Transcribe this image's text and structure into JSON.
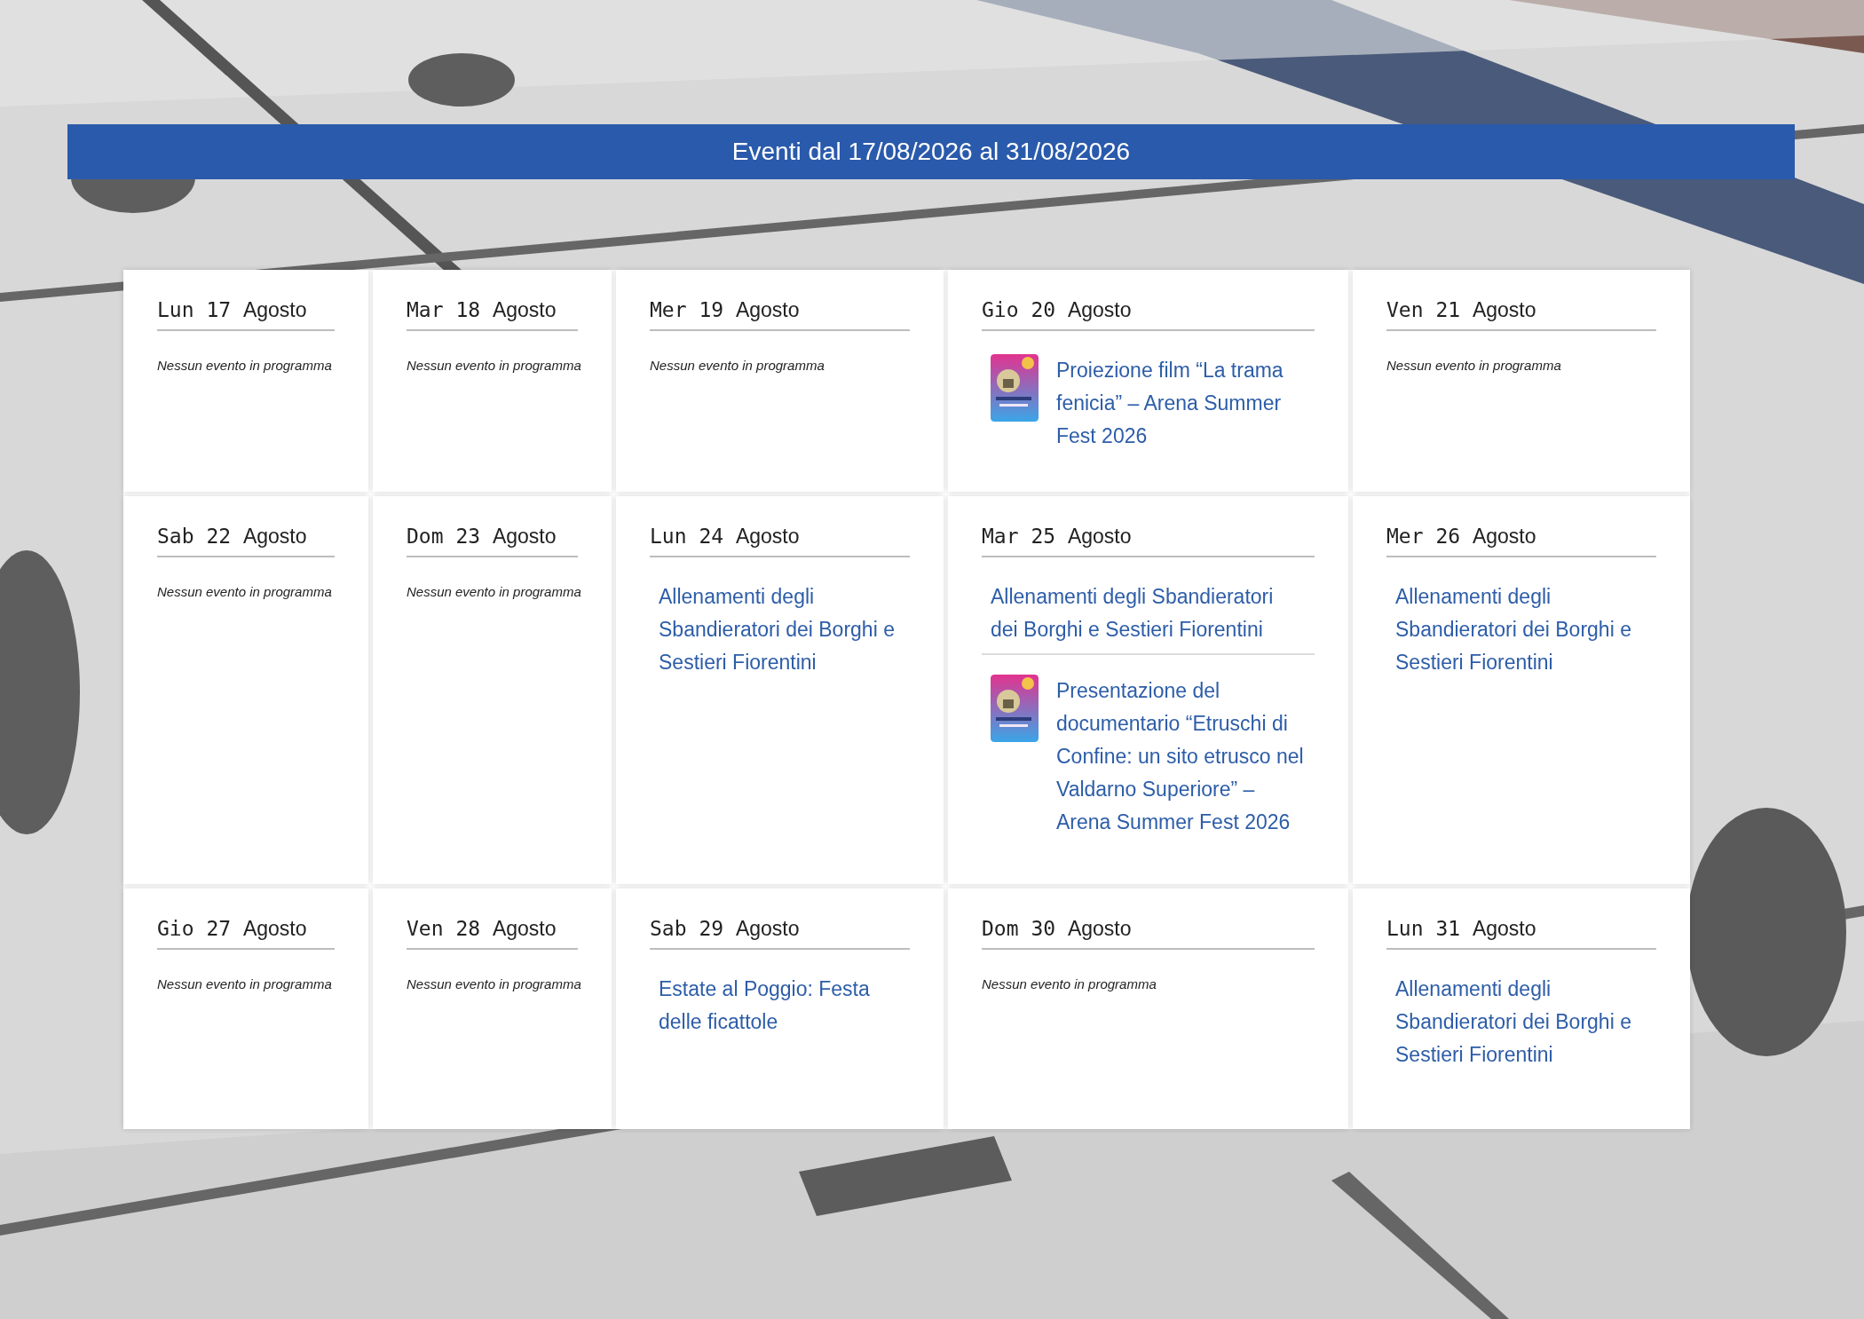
{
  "banner": {
    "title": "Eventi dal 17/08/2026 al 31/08/2026"
  },
  "days": [
    {
      "weekday": "Lun",
      "day": "17",
      "month": "Agosto",
      "empty_text": "Nessun evento in programma"
    },
    {
      "weekday": "Mar",
      "day": "18",
      "month": "Agosto",
      "empty_text": "Nessun evento in programma"
    },
    {
      "weekday": "Mer",
      "day": "19",
      "month": "Agosto",
      "empty_text": "Nessun evento in programma"
    },
    {
      "weekday": "Gio",
      "day": "20",
      "month": "Agosto",
      "events": [
        {
          "kind": "poster",
          "title": "Proiezione film “La trama fenicia” – Arena Summer Fest 2026"
        }
      ]
    },
    {
      "weekday": "Ven",
      "day": "21",
      "month": "Agosto",
      "empty_text": "Nessun evento in programma"
    },
    {
      "weekday": "Sab",
      "day": "22",
      "month": "Agosto",
      "empty_text": "Nessun evento in programma"
    },
    {
      "weekday": "Dom",
      "day": "23",
      "month": "Agosto",
      "empty_text": "Nessun evento in programma"
    },
    {
      "weekday": "Lun",
      "day": "24",
      "month": "Agosto",
      "events": [
        {
          "kind": "plain",
          "title": "Allenamenti degli Sbandieratori dei Borghi e Sestieri Fiorentini"
        }
      ]
    },
    {
      "weekday": "Mar",
      "day": "25",
      "month": "Agosto",
      "events": [
        {
          "kind": "plain",
          "title": "Allenamenti degli Sbandieratori dei Borghi e Sestieri Fiorentini"
        },
        {
          "kind": "poster",
          "title": "Presentazione del documentario “Etruschi di Confine: un sito etrusco nel Valdarno Superiore” – Arena Summer Fest 2026"
        }
      ]
    },
    {
      "weekday": "Mer",
      "day": "26",
      "month": "Agosto",
      "events": [
        {
          "kind": "plain",
          "title": "Allenamenti degli Sbandieratori dei Borghi e Sestieri Fiorentini"
        }
      ]
    },
    {
      "weekday": "Gio",
      "day": "27",
      "month": "Agosto",
      "empty_text": "Nessun evento in programma"
    },
    {
      "weekday": "Ven",
      "day": "28",
      "month": "Agosto",
      "empty_text": "Nessun evento in programma"
    },
    {
      "weekday": "Sab",
      "day": "29",
      "month": "Agosto",
      "events": [
        {
          "kind": "plain",
          "title": "Estate al Poggio: Festa delle ficattole"
        }
      ]
    },
    {
      "weekday": "Dom",
      "day": "30",
      "month": "Agosto",
      "empty_text": "Nessun evento in programma"
    },
    {
      "weekday": "Lun",
      "day": "31",
      "month": "Agosto",
      "events": [
        {
          "kind": "plain",
          "title": "Allenamenti degli Sbandieratori dei Borghi e Sestieri Fiorentini"
        }
      ]
    }
  ]
}
